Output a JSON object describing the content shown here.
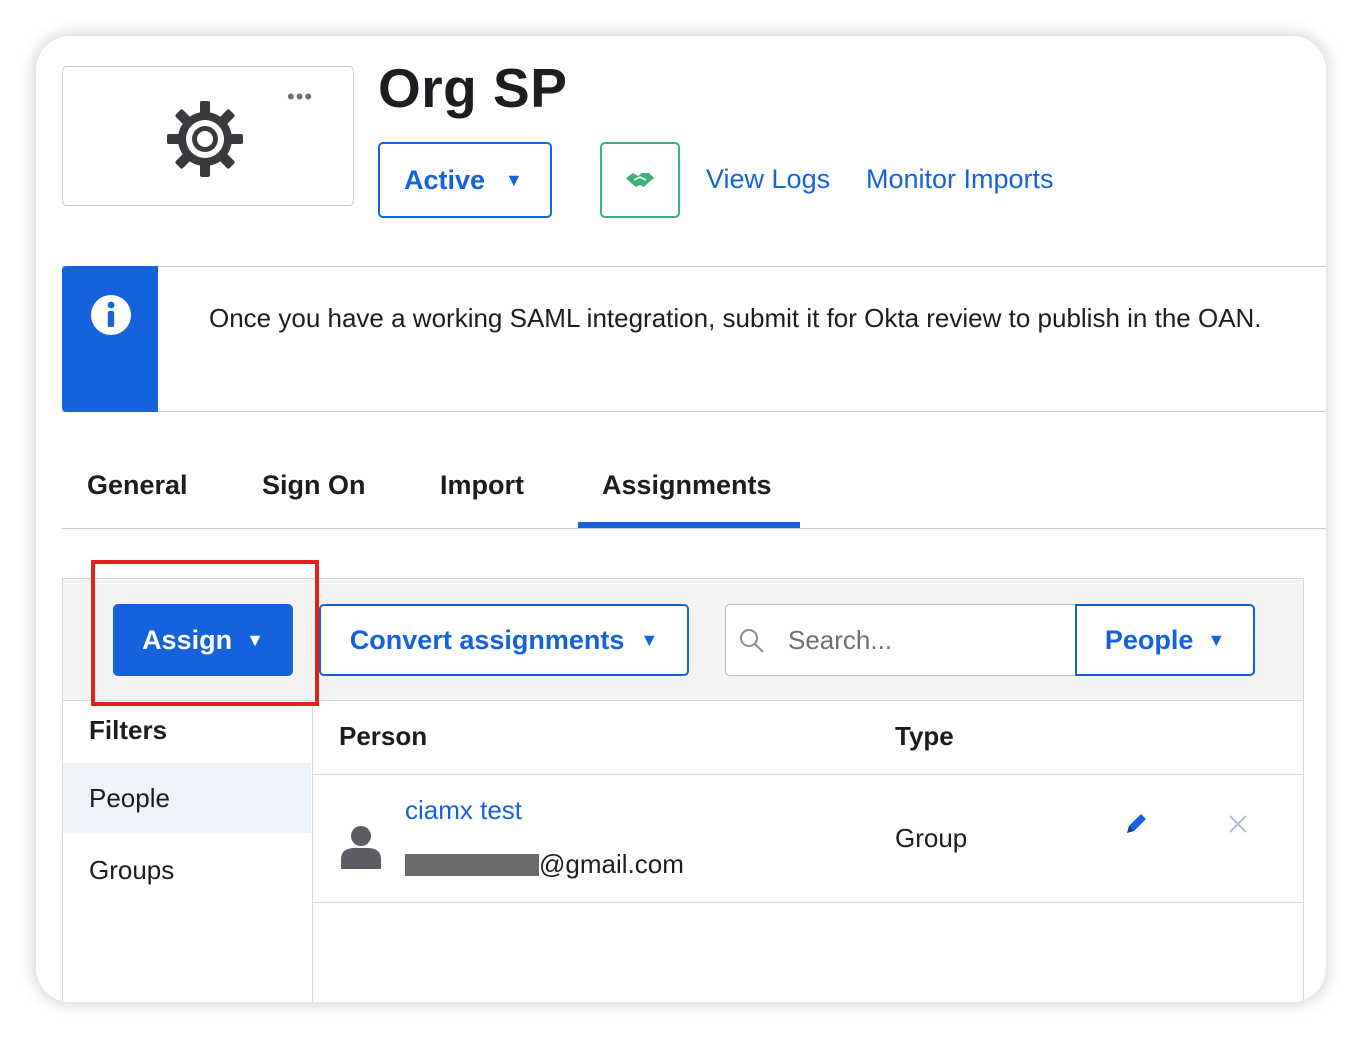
{
  "app": {
    "title": "Org SP",
    "more_label": "•••",
    "logo_icon": "gear-icon"
  },
  "header": {
    "status_label": "Active",
    "handshake_icon": "handshake-icon",
    "links": [
      "View Logs",
      "Monitor Imports"
    ]
  },
  "callout": {
    "icon": "info-icon",
    "message": "Once you have a working SAML integration, submit it for Okta review to publish in the OAN."
  },
  "tabs": [
    {
      "label": "General",
      "active": false
    },
    {
      "label": "Sign On",
      "active": false
    },
    {
      "label": "Import",
      "active": false
    },
    {
      "label": "Assignments",
      "active": true
    }
  ],
  "toolbar": {
    "assign_label": "Assign",
    "convert_label": "Convert assignments",
    "search_placeholder": "Search...",
    "filter_select_value": "People"
  },
  "filters": {
    "heading": "Filters",
    "items": [
      {
        "label": "People",
        "selected": true
      },
      {
        "label": "Groups",
        "selected": false
      }
    ]
  },
  "table": {
    "columns": [
      "Person",
      "Type"
    ],
    "rows": [
      {
        "name": "ciamx test",
        "email_suffix": "@gmail.com",
        "type": "Group"
      }
    ]
  },
  "colors": {
    "accent": "#1662dd",
    "success": "#40b07f",
    "highlight": "#e32119"
  }
}
